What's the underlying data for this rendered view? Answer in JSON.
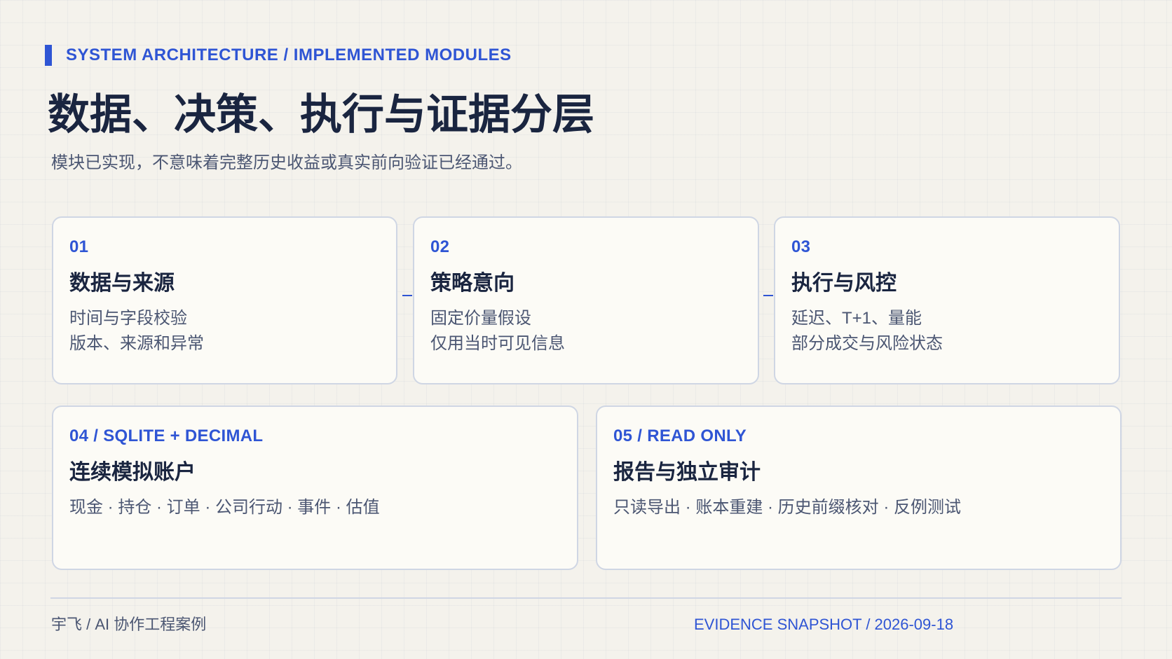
{
  "header": {
    "eyebrow": "SYSTEM ARCHITECTURE / IMPLEMENTED MODULES",
    "title": "数据、决策、执行与证据分层",
    "subtitle": "模块已实现，不意味着完整历史收益或真实前向验证已经通过。"
  },
  "modules": [
    {
      "number": "01",
      "title": "数据与来源",
      "lines": [
        "时间与字段校验",
        "版本、来源和异常"
      ]
    },
    {
      "number": "02",
      "title": "策略意向",
      "lines": [
        "固定价量假设",
        "仅用当时可见信息"
      ]
    },
    {
      "number": "03",
      "title": "执行与风控",
      "lines": [
        "延迟、T+1、量能",
        "部分成交与风险状态"
      ]
    },
    {
      "number": "04 / SQLITE + DECIMAL",
      "title": "连续模拟账户",
      "description": "现金 · 持仓 · 订单 · 公司行动 · 事件 · 估值"
    },
    {
      "number": "05 / READ ONLY",
      "title": "报告与独立审计",
      "description": "只读导出 · 账本重建 · 历史前缀核对 · 反例测试"
    }
  ],
  "footer": {
    "author": "宇飞 / AI 协作工程案例",
    "snapshot": "EVIDENCE SNAPSHOT / 2026-09-18"
  },
  "colors": {
    "accent": "#2f55d4",
    "heading": "#1a2540",
    "body": "#4b5672",
    "card_border": "#cfd6e4",
    "card_bg": "#fcfbf6",
    "page_bg": "#f4f2ec"
  }
}
